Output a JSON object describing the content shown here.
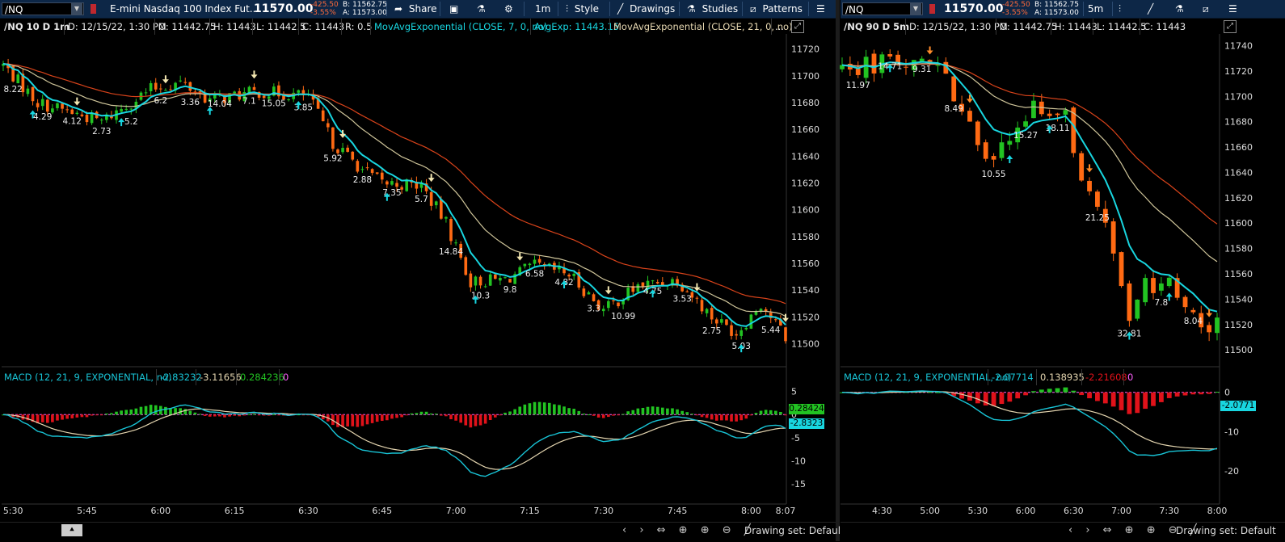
{
  "left_toolbar": {
    "symbol": "/NQ",
    "description": "E-mini Nasdaq 100 Index Fut...",
    "last": "11570.00",
    "change": "-425.50",
    "change_pct": "-3.55%",
    "bid": "B: 11562.75",
    "ask": "A: 11573.00",
    "share": "Share",
    "timeframe": "1m",
    "style": "Style",
    "drawings": "Drawings",
    "studies": "Studies",
    "patterns": "Patterns"
  },
  "right_toolbar": {
    "symbol": "/NQ",
    "last": "11570.00",
    "change": "-425.50",
    "change_pct": "-3.55%",
    "bid": "B: 11562.75",
    "ask": "A: 11573.00",
    "timeframe": "5m"
  },
  "left_info": {
    "title": "/NQ 10 D 1m",
    "date": "D: 12/15/22, 1:30 PM",
    "open": "O: 11442.75",
    "high": "H: 11443",
    "low": "L: 11442.5",
    "close": "C: 11443",
    "range": "R: 0.5",
    "ema7": "MovAvgExponential (CLOSE, 7, 0, no)",
    "ema7_val": "AvgExp: 11443.15",
    "ema21": "MovAvgExponential (CLOSE, 21, 0, no)",
    "more": "..."
  },
  "right_info": {
    "title": "/NQ 90 D 5m",
    "date": "D: 12/15/22, 1:30 PM",
    "open": "O: 11442.75",
    "high": "H: 11443",
    "low": "L: 11442.5",
    "close": "C: 11443"
  },
  "left_macd_info": {
    "label": "MACD (12, 21, 9, EXPONENTIAL, no)",
    "value": "-2.83232",
    "avg": "-3.11656",
    "diff": "0.284236",
    "zero": "0",
    "diff_tag": "0.28424",
    "value_tag": "-2.8323"
  },
  "right_macd_info": {
    "label": "MACD (12, 21, 9, EXPONENTIAL, no)",
    "value": "-2.07714",
    "avg": "0.138935",
    "diff": "-2.21608",
    "zero": "0",
    "value_tag": "-2.0771"
  },
  "bottom": {
    "left_drawing_set": "Drawing set: Default",
    "right_drawing_set": "Drawing set: Default"
  },
  "colors": {
    "up": "#22c322",
    "down": "#ff6a13",
    "ema7": "#18d6e0",
    "ema21": "#cfc59a",
    "ema_slow": "#d9431a",
    "macd_line": "#18c4d6",
    "macd_avg": "#e5d6b0",
    "hist_up": "#22c322",
    "hist_down": "#e0121a",
    "toolbar": "#0d2747"
  },
  "chart_data": [
    {
      "type": "candlestick",
      "title": "/NQ 10 D 1m",
      "x_ticks": [
        "5:30",
        "5:45",
        "6:00",
        "6:15",
        "6:30",
        "6:45",
        "7:00",
        "7:15",
        "7:30",
        "7:45",
        "8:00",
        "8:07"
      ],
      "y_ticks": [
        11720,
        11700,
        11680,
        11660,
        11640,
        11620,
        11600,
        11580,
        11560,
        11540,
        11520,
        11500
      ],
      "ylim": [
        11484,
        11730
      ],
      "xlim": [
        "5:28",
        "8:07"
      ],
      "key_closes": [
        {
          "x": "5:28",
          "y": 11708
        },
        {
          "x": "5:35",
          "y": 11680
        },
        {
          "x": "5:48",
          "y": 11666
        },
        {
          "x": "5:58",
          "y": 11690
        },
        {
          "x": "6:04",
          "y": 11695
        },
        {
          "x": "6:10",
          "y": 11682
        },
        {
          "x": "6:20",
          "y": 11688
        },
        {
          "x": "6:30",
          "y": 11685
        },
        {
          "x": "6:35",
          "y": 11650
        },
        {
          "x": "6:41",
          "y": 11630
        },
        {
          "x": "6:45",
          "y": 11620
        },
        {
          "x": "6:53",
          "y": 11618
        },
        {
          "x": "6:58",
          "y": 11590
        },
        {
          "x": "7:03",
          "y": 11546
        },
        {
          "x": "7:10",
          "y": 11548
        },
        {
          "x": "7:16",
          "y": 11558
        },
        {
          "x": "7:23",
          "y": 11552
        },
        {
          "x": "7:30",
          "y": 11525
        },
        {
          "x": "7:37",
          "y": 11543
        },
        {
          "x": "7:45",
          "y": 11548
        },
        {
          "x": "7:52",
          "y": 11520
        },
        {
          "x": "7:57",
          "y": 11508
        },
        {
          "x": "8:02",
          "y": 11530
        },
        {
          "x": "8:07",
          "y": 11505
        }
      ],
      "annotations": [
        "8.22",
        "4.29",
        "4.12",
        "2.73",
        "5.2",
        "6.2",
        "3.36",
        "14.04",
        "7.1",
        "15.05",
        "3.85",
        "5.92",
        "2.88",
        "7.35",
        "5.7",
        "14.84",
        "10.3",
        "9.8",
        "6.58",
        "4.82",
        "3.3",
        "10.99",
        "4.75",
        "3.53",
        "2.75",
        "5.03",
        "5.44"
      ],
      "series": [
        {
          "name": "MovAvgExponential (CLOSE, 7, 0, no)",
          "last": 11443.15
        },
        {
          "name": "MovAvgExponential (CLOSE, 21, 0, no)"
        }
      ]
    },
    {
      "type": "line",
      "title": "MACD (12, 21, 9, EXPONENTIAL, no)",
      "y_ticks": [
        5,
        0,
        -5,
        -10,
        -15
      ],
      "ylim": [
        -19,
        6.5
      ],
      "series": [
        {
          "name": "Value",
          "last": -2.83232
        },
        {
          "name": "Avg",
          "last": -3.11656
        },
        {
          "name": "Diff",
          "last": 0.284236
        }
      ]
    },
    {
      "type": "candlestick",
      "title": "/NQ 90 D 5m",
      "x_ticks": [
        "4:30",
        "5:00",
        "5:30",
        "6:00",
        "6:30",
        "7:00",
        "7:30",
        "8:00"
      ],
      "y_ticks": [
        11740,
        11720,
        11700,
        11680,
        11660,
        11640,
        11620,
        11600,
        11580,
        11560,
        11540,
        11520,
        11500
      ],
      "ylim": [
        11488,
        11748
      ],
      "xlim": [
        "4:05",
        "8:00"
      ],
      "key_closes": [
        {
          "x": "4:05",
          "y": 11722
        },
        {
          "x": "4:30",
          "y": 11728
        },
        {
          "x": "4:50",
          "y": 11733
        },
        {
          "x": "5:05",
          "y": 11723
        },
        {
          "x": "5:15",
          "y": 11700
        },
        {
          "x": "5:30",
          "y": 11670
        },
        {
          "x": "5:40",
          "y": 11648
        },
        {
          "x": "5:50",
          "y": 11662
        },
        {
          "x": "6:05",
          "y": 11690
        },
        {
          "x": "6:20",
          "y": 11682
        },
        {
          "x": "6:25",
          "y": 11688
        },
        {
          "x": "6:35",
          "y": 11640
        },
        {
          "x": "6:45",
          "y": 11610
        },
        {
          "x": "6:55",
          "y": 11575
        },
        {
          "x": "7:05",
          "y": 11525
        },
        {
          "x": "7:15",
          "y": 11548
        },
        {
          "x": "7:30",
          "y": 11550
        },
        {
          "x": "7:45",
          "y": 11525
        },
        {
          "x": "8:00",
          "y": 11520
        }
      ],
      "annotations": [
        "11.97",
        "14.71",
        "9.31",
        "8.49",
        "10.55",
        "15.27",
        "18.11",
        "21.25",
        "32.81",
        "7.8",
        "8.04"
      ]
    },
    {
      "type": "line",
      "title": "MACD (12, 21, 9, EXPONENTIAL, no)",
      "y_ticks": [
        0,
        -10,
        -20
      ],
      "ylim": [
        -28,
        2
      ],
      "series": [
        {
          "name": "Value",
          "last": -2.07714
        },
        {
          "name": "Avg",
          "last": 0.138935
        },
        {
          "name": "Diff",
          "last": -2.21608
        }
      ]
    }
  ]
}
